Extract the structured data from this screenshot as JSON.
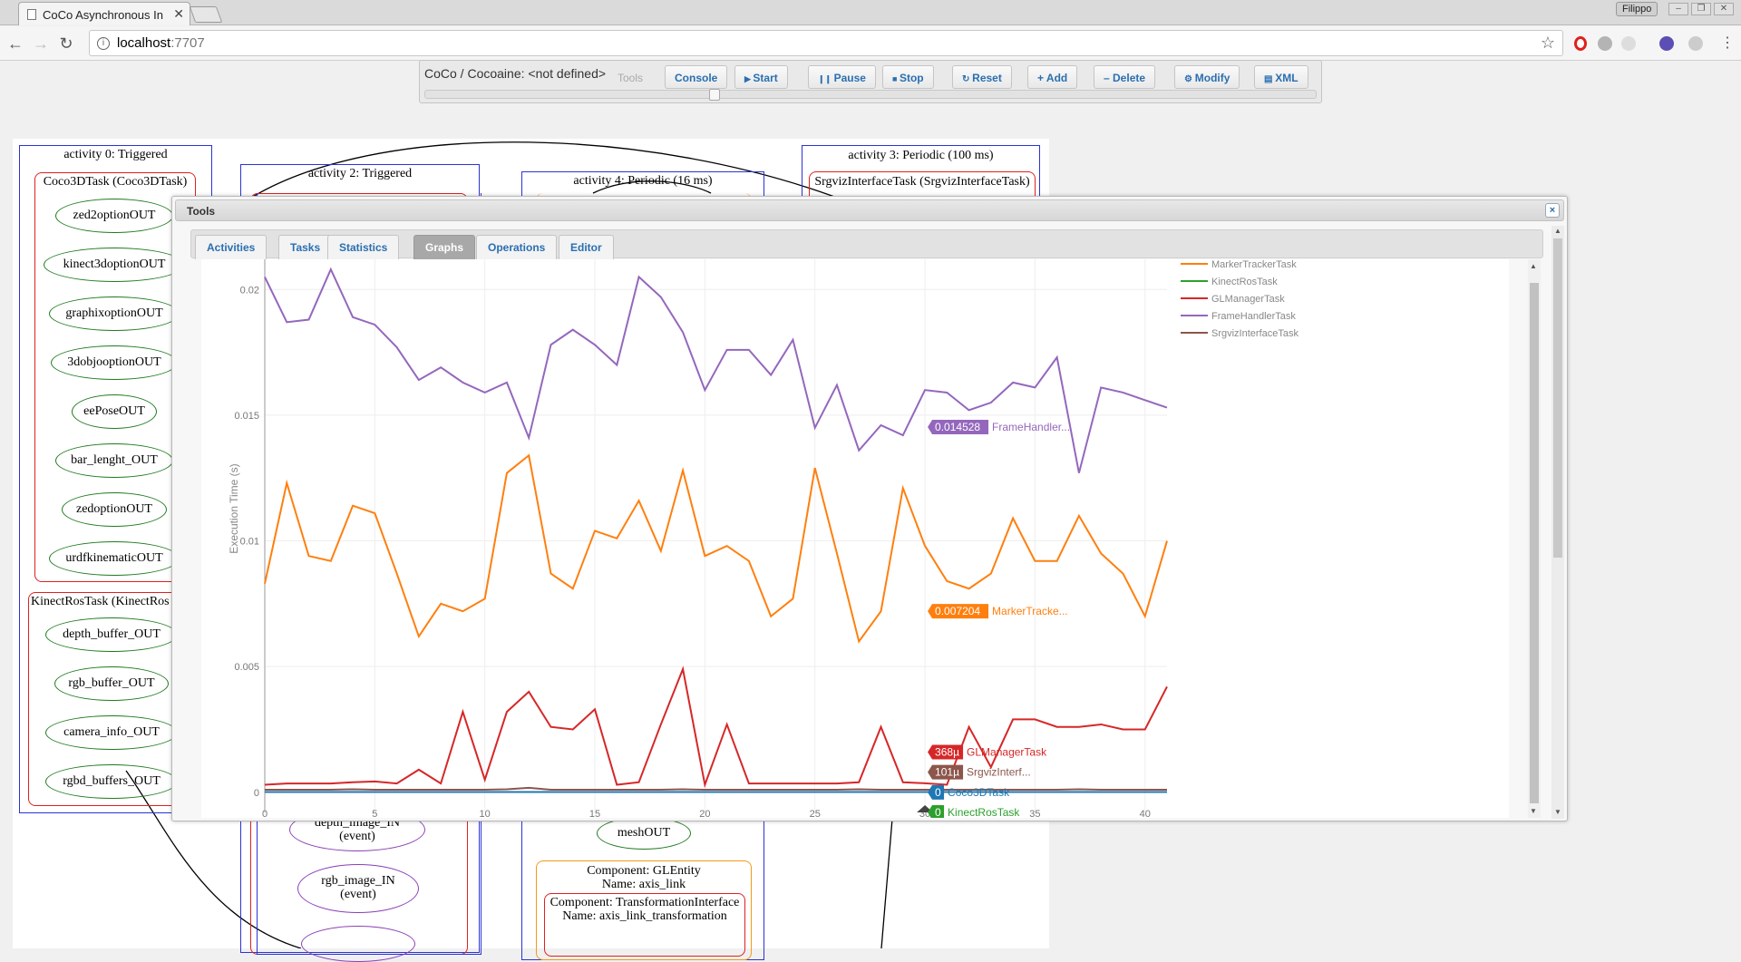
{
  "browser": {
    "tab_title": "CoCo Asynchronous In",
    "url_host": "localhost",
    "url_port": ":7707",
    "profile": "Filippo"
  },
  "app": {
    "title": "CoCo / Cocoaine: <not defined>",
    "buttons": {
      "tools": "Tools",
      "console": "Console",
      "start": "Start",
      "pause": "Pause",
      "stop": "Stop",
      "reset": "Reset",
      "add": "Add",
      "delete": "Delete",
      "modify": "Modify",
      "xml": "XML"
    },
    "icons": {
      "start": "play-icon",
      "pause": "pause-icon",
      "stop": "stop-icon",
      "reset": "refresh-icon",
      "add": "plus-icon",
      "delete": "minus-icon",
      "modify": "gear-icon",
      "xml": "document-icon"
    }
  },
  "graph": {
    "activity0": "activity 0: Triggered",
    "coco3d_task": "Coco3DTask (Coco3DTask)",
    "coco3d_ports": [
      "zed2optionOUT",
      "kinect3doptionOUT",
      "graphixoptionOUT",
      "3dobjooptionOUT",
      "eePoseOUT",
      "bar_lenght_OUT",
      "zedoptionOUT",
      "urdfkinematicOUT"
    ],
    "kinect_task": "KinectRosTask (KinectRos",
    "kinect_ports": [
      "depth_buffer_OUT",
      "rgb_buffer_OUT",
      "camera_info_OUT",
      "rgbd_buffers_OUT"
    ],
    "activity2": "activity 2: Triggered",
    "activity4": "activity 4: Periodic (16 ms)",
    "activity3": "activity 3: Periodic (100 ms)",
    "srgviz_task": "SrgvizInterfaceTask (SrgvizInterfaceTask)",
    "depth_in_1": "depth_image_IN",
    "depth_in_2": "(event)",
    "rgb_in_1": "rgb_image_IN",
    "rgb_in_2": "(event)",
    "mesh_out": "meshOUT",
    "component_gl_1": "Component: GLEntity",
    "component_gl_2": "Name: axis_link",
    "component_ti_1": "Component: TransformationInterface",
    "component_ti_2": "Name: axis_link_transformation"
  },
  "dialog": {
    "title": "Tools",
    "close": "×",
    "tabs": [
      "Activities",
      "Tasks",
      "Statistics",
      "Graphs",
      "Operations",
      "Editor"
    ],
    "active_tab": "Graphs"
  },
  "chart_data": {
    "type": "line",
    "xlabel": "",
    "ylabel": "Execution Time (s)",
    "xlim": [
      0,
      41
    ],
    "ylim": [
      -0.0008,
      0.0212
    ],
    "xticks": [
      0,
      5,
      10,
      15,
      20,
      25,
      30,
      35,
      40
    ],
    "yticks": [
      0,
      0.005,
      0.01,
      0.015,
      0.02
    ],
    "ytick_labels": [
      "0",
      "0.005",
      "0.01",
      "0.015",
      "0.02"
    ],
    "legend_position": "top-right",
    "series": [
      {
        "name": "MarkerTrackerTask",
        "color": "#ff7f0e",
        "values": [
          0.0083,
          0.0123,
          0.0094,
          0.0092,
          0.0114,
          0.0111,
          0.0087,
          0.0062,
          0.0075,
          0.0072,
          0.0077,
          0.0127,
          0.0134,
          0.0087,
          0.0081,
          0.0104,
          0.0101,
          0.0116,
          0.0096,
          0.0128,
          0.0094,
          0.0098,
          0.0092,
          0.007,
          0.0077,
          0.0129,
          0.0095,
          0.006,
          0.0072,
          0.0121,
          0.0098,
          0.0084,
          0.0081,
          0.0087,
          0.0109,
          0.0092,
          0.0092,
          0.011,
          0.0095,
          0.0087,
          0.007,
          0.01
        ]
      },
      {
        "name": "KinectRosTask",
        "color": "#2ca02c",
        "values": [
          1e-05,
          1e-05,
          1e-05,
          1e-05,
          1e-05,
          1e-05,
          1e-05,
          1e-05,
          1e-05,
          1e-05,
          1e-05,
          1e-05,
          1e-05,
          1e-05,
          1e-05,
          1e-05,
          1e-05,
          1e-05,
          1e-05,
          1e-05,
          1e-05,
          1e-05,
          1e-05,
          1e-05,
          1e-05,
          1e-05,
          1e-05,
          1e-05,
          1e-05,
          1e-05,
          1e-05,
          1e-05,
          1e-05,
          1e-05,
          1e-05,
          1e-05,
          1e-05,
          1e-05,
          1e-05,
          1e-05,
          1e-05,
          1e-05
        ]
      },
      {
        "name": "GLManagerTask",
        "color": "#d62728",
        "values": [
          0.0003,
          0.00035,
          0.00035,
          0.00035,
          0.0004,
          0.00043,
          0.00035,
          0.0009,
          0.00035,
          0.0032,
          0.0005,
          0.0032,
          0.004,
          0.0026,
          0.0025,
          0.0033,
          0.0003,
          0.0004,
          0.0027,
          0.0049,
          0.0003,
          0.0027,
          0.00035,
          0.00035,
          0.00035,
          0.00035,
          0.00035,
          0.0004,
          0.0026,
          0.0004,
          0.00036,
          0.0003,
          0.0026,
          0.001,
          0.0029,
          0.0029,
          0.0026,
          0.0026,
          0.0027,
          0.0025,
          0.0025,
          0.0042
        ]
      },
      {
        "name": "FrameHandlerTask",
        "color": "#9467bd",
        "values": [
          0.0205,
          0.0187,
          0.0188,
          0.0208,
          0.0189,
          0.0186,
          0.0177,
          0.0164,
          0.0169,
          0.0163,
          0.0159,
          0.0163,
          0.0141,
          0.0178,
          0.0184,
          0.0178,
          0.017,
          0.0205,
          0.0197,
          0.0183,
          0.016,
          0.0176,
          0.0176,
          0.0166,
          0.018,
          0.0145,
          0.0162,
          0.0136,
          0.0146,
          0.0142,
          0.016,
          0.0159,
          0.0152,
          0.0155,
          0.0163,
          0.0161,
          0.0173,
          0.0127,
          0.0161,
          0.0159,
          0.0156,
          0.0153
        ]
      },
      {
        "name": "SrgvizInterfaceTask",
        "color": "#8c564b",
        "values": [
          0.0001,
          0.0001,
          0.0001,
          0.0001,
          0.00012,
          0.0001,
          0.0001,
          0.0001,
          0.0001,
          0.0001,
          0.0001,
          0.00012,
          0.00018,
          0.0001,
          0.0001,
          0.0001,
          0.0001,
          0.0001,
          0.0001,
          0.00012,
          0.0001,
          0.0001,
          0.0001,
          0.0001,
          0.0001,
          0.0001,
          0.0001,
          0.00012,
          0.0001,
          0.0001,
          0.0001,
          0.0001,
          0.0001,
          0.0001,
          0.0001,
          0.0001,
          0.0001,
          0.00012,
          0.0001,
          0.0001,
          0.0001,
          0.0001
        ]
      },
      {
        "name": "Coco3DTask",
        "color": "#1f77b4",
        "values": [
          1e-05,
          1e-05,
          1e-05,
          1e-05,
          1e-05,
          1e-05,
          1e-05,
          1e-05,
          1e-05,
          1e-05,
          1e-05,
          1e-05,
          1e-05,
          1e-05,
          1e-05,
          1e-05,
          1e-05,
          1e-05,
          1e-05,
          1e-05,
          1e-05,
          1e-05,
          1e-05,
          1e-05,
          1e-05,
          1e-05,
          1e-05,
          1e-05,
          1e-05,
          1e-05,
          1e-05,
          1e-05,
          1e-05,
          1e-05,
          1e-05,
          1e-05,
          1e-05,
          1e-05,
          1e-05,
          1e-05,
          1e-05,
          1e-05
        ]
      }
    ],
    "legend": [
      "MarkerTrackerTask",
      "KinectRosTask",
      "GLManagerTask",
      "FrameHandlerTask",
      "SrgvizInterfaceTask"
    ],
    "hover_x": 30,
    "hover_labels": [
      {
        "value": "0.014528",
        "name": "FrameHandler...",
        "color": "#9467bd",
        "data_y": 0.014528
      },
      {
        "value": "0.007204",
        "name": "MarkerTracke...",
        "color": "#ff7f0e",
        "data_y": 0.007204
      },
      {
        "value": "368µ",
        "name": "GLManagerTask",
        "color": "#d62728",
        "data_y": 0.0016
      },
      {
        "value": "101µ",
        "name": "SrgvizInterf...",
        "color": "#8c564b",
        "data_y": 0.0008
      },
      {
        "value": "0",
        "name": "Coco3DTask",
        "color": "#1f77b4",
        "data_y": 0.0
      },
      {
        "value": "0",
        "name": "KinectRosTask",
        "color": "#2ca02c",
        "data_y": -0.0008
      }
    ]
  }
}
